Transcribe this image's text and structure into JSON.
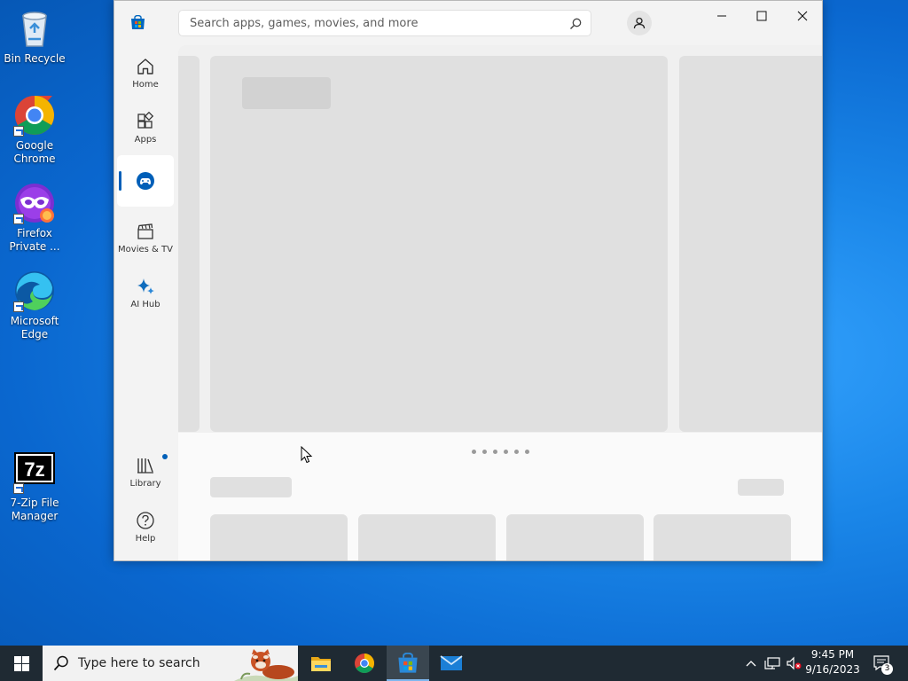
{
  "desktop": {
    "icons": [
      {
        "label": "Bin Recycle"
      },
      {
        "label": "Google Chrome"
      },
      {
        "label": "Firefox Private ..."
      },
      {
        "label": "Microsoft Edge"
      },
      {
        "label": "7-Zip File Manager"
      }
    ]
  },
  "store": {
    "search_placeholder": "Search apps, games, movies, and more",
    "nav": [
      {
        "label": "Home"
      },
      {
        "label": "Apps"
      },
      {
        "label": "Gaming"
      },
      {
        "label": "Movies & TV"
      },
      {
        "label": "AI Hub"
      },
      {
        "label": "Library"
      },
      {
        "label": "Help"
      }
    ],
    "active_nav": "Gaming",
    "carousel_pages": 6
  },
  "taskbar": {
    "search_placeholder": "Type here to search",
    "time": "9:45 PM",
    "date": "9/16/2023",
    "notification_count": "3"
  },
  "colors": {
    "accent": "#005fb8",
    "taskbar": "#1f2a33",
    "placeholder": "#e0e0e0"
  }
}
